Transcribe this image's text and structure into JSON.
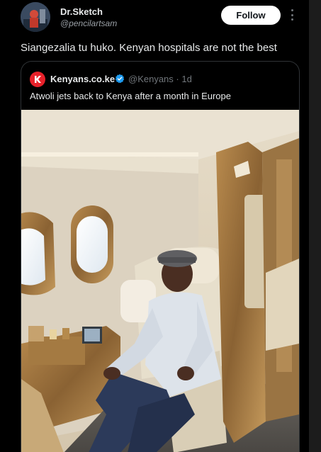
{
  "post": {
    "display_name": "Dr.Sketch",
    "handle": "@pencilartsam",
    "follow_label": "Follow",
    "text": "Siangezalia tu huko. Kenyan hospitals are not the best"
  },
  "quoted": {
    "display_name": "Kenyans.co.ke",
    "handle_time": "@Kenyans · 1d",
    "text": "Atwoli jets back to Kenya after a month in Europe"
  },
  "colors": {
    "background": "#000000",
    "text": "#e7e9ea",
    "secondary_text": "#71767b",
    "follow_button_bg": "#ffffff",
    "verified_blue": "#1d9bf0",
    "brand_red": "#e8212a"
  }
}
